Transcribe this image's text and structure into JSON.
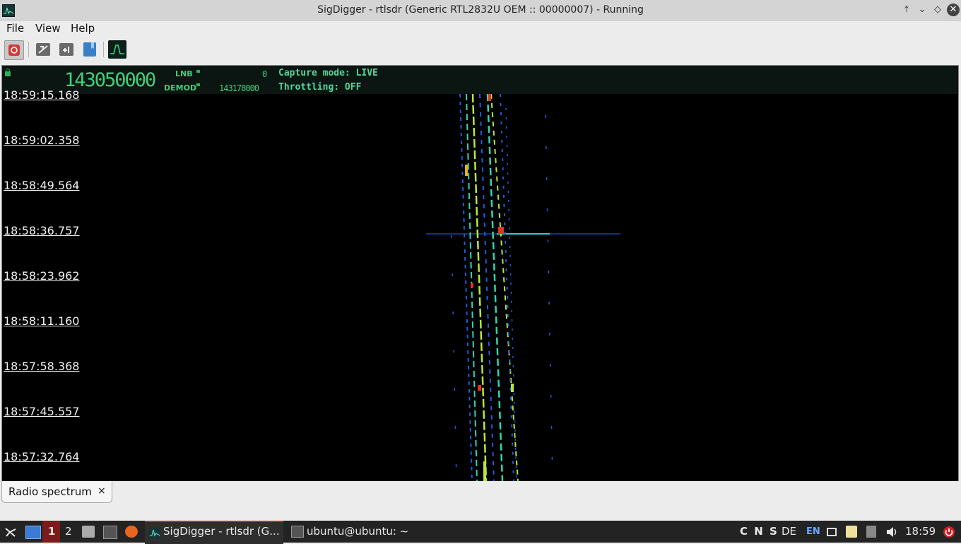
{
  "window": {
    "title": "SigDigger - rtlsdr (Generic RTL2832U OEM :: 00000007) - Running"
  },
  "menu": {
    "file": "File",
    "view": "View",
    "help": "Help"
  },
  "toolbar": {
    "buttons": [
      "record-icon",
      "settings-icon",
      "add-icon",
      "bookmark-icon",
      "spectrum-icon"
    ]
  },
  "lcd": {
    "frequency": "143050000",
    "lnb_label": "LNB",
    "lnb_value": "0",
    "demod_label": "DEMOD",
    "demod_value": "143178000",
    "capture_mode": "Capture mode: LIVE",
    "throttling": "Throttling: OFF"
  },
  "waterfall": {
    "timestamps": [
      "18:59:15.168",
      "18:59:02.358",
      "18:58:49.564",
      "18:58:36.757",
      "18:58:23.962",
      "18:58:11.160",
      "18:57:58.368",
      "18:57:45.557",
      "18:57:32.764"
    ]
  },
  "tabs": [
    {
      "label": "Radio spectrum",
      "close": "×"
    }
  ],
  "taskbar": {
    "workspace_1": "1",
    "workspace_2": "2",
    "task_sigdigger": "SigDigger - rtlsdr (G...",
    "task_terminal": "ubuntu@ubuntu: ~",
    "indicators": "C N S",
    "kbd_de": "DE",
    "kbd_en": "EN",
    "clock": "18:59"
  },
  "colors": {
    "lcd_green": "#3fcf7a",
    "waterfall_bg": "#000000",
    "taskbar_bg": "#232323"
  }
}
